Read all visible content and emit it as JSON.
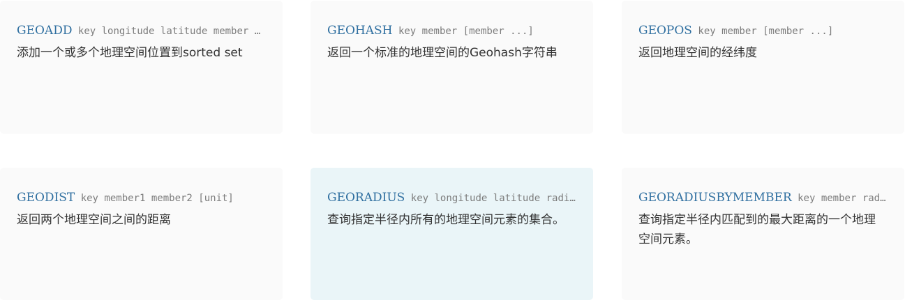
{
  "commands": [
    {
      "name": "GEOADD",
      "args": "key longitude latitude member [longitude latitude member ...]",
      "description": "添加一个或多个地理空间位置到sorted set"
    },
    {
      "name": "GEOHASH",
      "args": "key member [member ...]",
      "description": "返回一个标准的地理空间的Geohash字符串"
    },
    {
      "name": "GEOPOS",
      "args": "key member [member ...]",
      "description": "返回地理空间的经纬度"
    },
    {
      "name": "GEODIST",
      "args": "key member1 member2 [unit]",
      "description": "返回两个地理空间之间的距离"
    },
    {
      "name": "GEORADIUS",
      "args": "key longitude latitude radius m|km|ft|mi [WITHCOORD] [WITHDIST] [WITHHASH] [COUNT count]",
      "description": "查询指定半径内所有的地理空间元素的集合。"
    },
    {
      "name": "GEORADIUSBYMEMBER",
      "args": "key member radius m|km|ft|mi [WITHCOORD] [WITHDIST] [WITHHASH] [COUNT count]",
      "description": "查询指定半径内匹配到的最大距离的一个地理空间元素。"
    }
  ],
  "colors": {
    "card_bg": "#fafafa",
    "card_hover_bg": "#eaf5f8",
    "command": "#2f6fa0",
    "args": "#7b7b7b",
    "text": "#333333"
  }
}
